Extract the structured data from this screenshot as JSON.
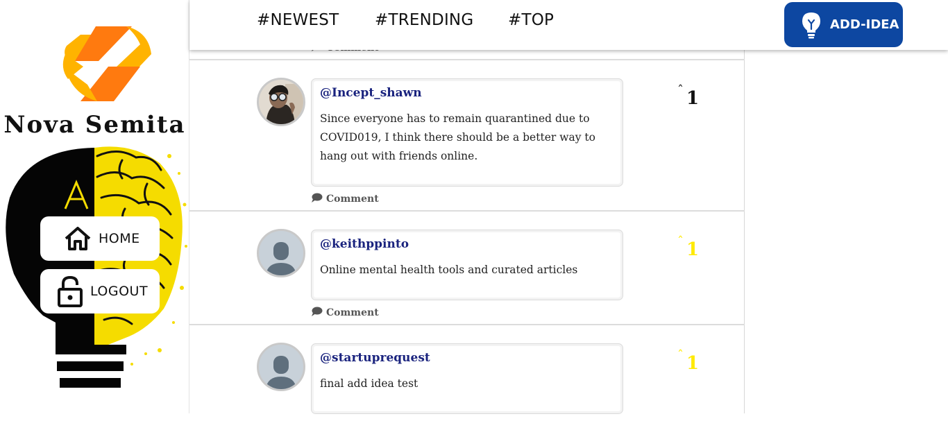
{
  "brand": {
    "name": "Nova Semita"
  },
  "sidebar": {
    "home_label": "HOME",
    "logout_label": "LOGOUT"
  },
  "header": {
    "tabs": [
      {
        "label": "#NEWEST"
      },
      {
        "label": "#TRENDING"
      },
      {
        "label": "#TOP"
      }
    ],
    "add_idea_label": "ADD-IDEA"
  },
  "colors": {
    "accent_blue": "#0d47a1",
    "handle": "#1a237e",
    "vote_active": "#111111",
    "vote_inactive": "#ffea00",
    "logo_orange": "#ff7a0f",
    "logo_yellow": "#ffb300",
    "brain_yellow": "#f5dc00"
  },
  "feed": {
    "comment_label": "Comment",
    "posts": [
      {
        "handle": "@Incept_shawn",
        "text": "Since everyone has to remain quarantined due to COVID019, I think there should be a better way to hang out with friends online.",
        "votes": "1",
        "voted": true,
        "avatar": "photo"
      },
      {
        "handle": "@keithppinto",
        "text": "Online mental health tools and curated articles",
        "votes": "1",
        "voted": false,
        "avatar": "default-user-icon"
      },
      {
        "handle": "@startuprequest",
        "text": "final add idea test",
        "votes": "1",
        "voted": false,
        "avatar": "default-user-icon"
      }
    ]
  }
}
